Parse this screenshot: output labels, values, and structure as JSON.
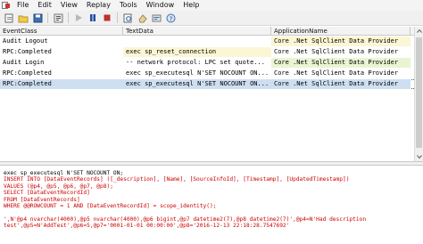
{
  "menu": {
    "items": [
      "File",
      "Edit",
      "View",
      "Replay",
      "Tools",
      "Window",
      "Help"
    ]
  },
  "toolbar": {
    "buttons": [
      "new-trace",
      "open",
      "save",
      "properties",
      "run",
      "pause",
      "stop",
      "find",
      "clear",
      "settings",
      "help"
    ]
  },
  "grid": {
    "columns": [
      "EventClass",
      "TextData",
      "ApplicationName"
    ],
    "rows": [
      {
        "event": "Audit Logout",
        "text": "",
        "app": "Core .Net SqlClient Data Provider"
      },
      {
        "event": "RPC:Completed",
        "text": "exec sp_reset_connection",
        "app": "Core .Net SqlClient Data Provider"
      },
      {
        "event": "Audit Login",
        "text": "-- network protocol: LPC  set quote...",
        "app": "Core .Net SqlClient Data Provider"
      },
      {
        "event": "RPC:Completed",
        "text": "exec sp_executesql N'SET NOCOUNT ON...",
        "app": "Core .Net SqlClient Data Provider"
      },
      {
        "event": "RPC:Completed",
        "text": "exec sp_executesql N'SET NOCOUNT ON...",
        "app": "Core .Net SqlClient Data Provider"
      }
    ]
  },
  "detail": {
    "lines": [
      "exec sp_executesql N'SET NOCOUNT ON;",
      "INSERT INTO [DataEventRecords] ([_description], [Name], [SourceInfoId], [Timestamp], [UpdatedTimestamp])",
      "VALUES (@p4, @p5, @p6, @p7, @p8);",
      "SELECT [DataEventRecordId]",
      "FROM [DataEventRecords]",
      "WHERE @@ROWCOUNT = 1 AND [DataEventRecordId] = scope_identity();",
      "",
      "',N'@p4 nvarchar(4000),@p5 nvarchar(4000),@p6 bigint,@p7 datetime2(7),@p8 datetime2(7)',@p4=N'Had description",
      "test',@p5=N'AddTest',@p6=5,@p7='0001-01-01 00:00:00',@p8='2016-12-13 22:18:28.7547692'"
    ]
  },
  "colors": {
    "selection": "#cfdff2",
    "sql_text": "#cc0000",
    "highlight_yellow": "#fbf6d3"
  }
}
